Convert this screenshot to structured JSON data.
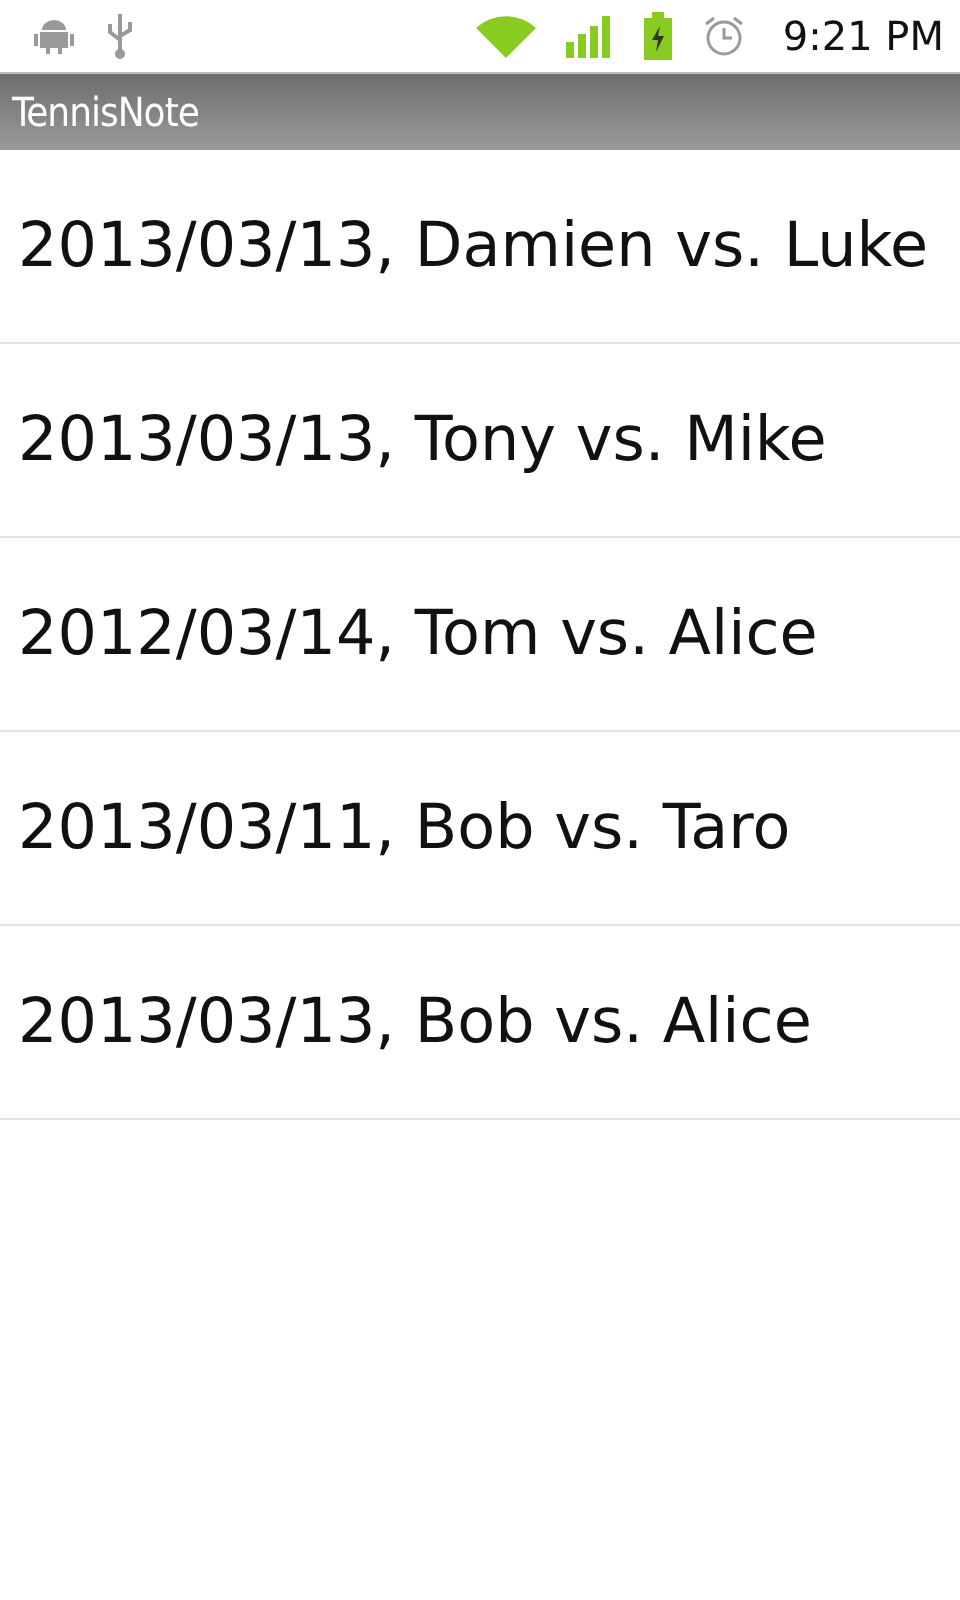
{
  "status_bar": {
    "time": "9:21 PM"
  },
  "title_bar": {
    "title": "TennisNote"
  },
  "matches": [
    {
      "label": "2013/03/13, Damien vs. Luke"
    },
    {
      "label": "2013/03/13, Tony vs. Mike"
    },
    {
      "label": "2012/03/14, Tom vs. Alice"
    },
    {
      "label": "2013/03/11, Bob vs. Taro"
    },
    {
      "label": "2013/03/13, Bob vs. Alice"
    }
  ]
}
